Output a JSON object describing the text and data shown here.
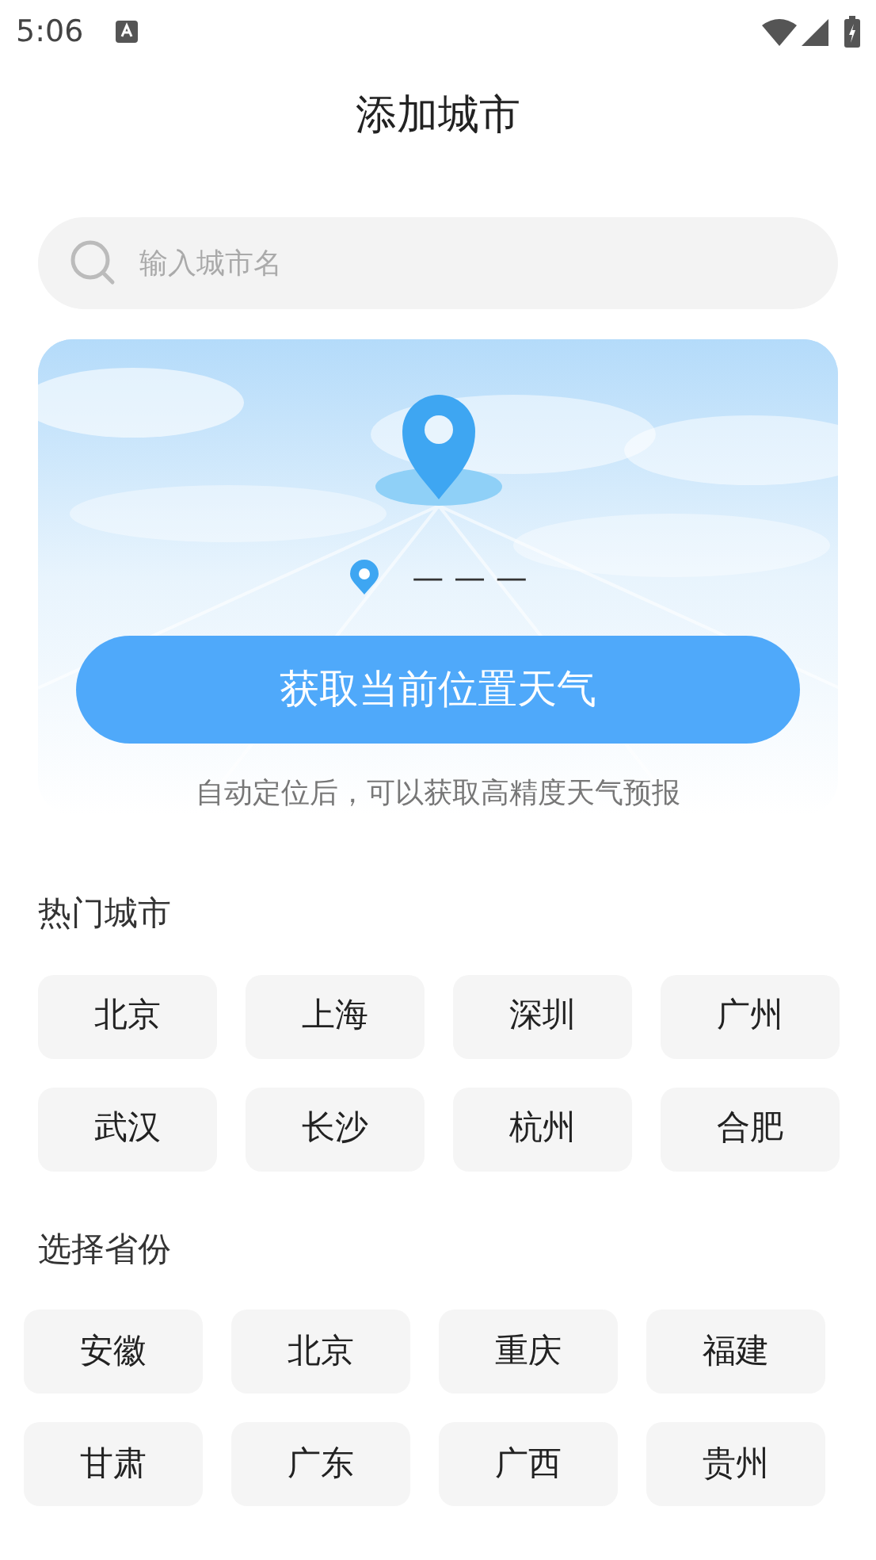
{
  "status_bar": {
    "time": "5:06"
  },
  "title": "添加城市",
  "search": {
    "placeholder": "输入城市名"
  },
  "location_card": {
    "place": "— — —",
    "button": "获取当前位置天气",
    "note": "自动定位后，可以获取高精度天气预报"
  },
  "hot_cities": {
    "heading": "热门城市",
    "items": [
      "北京",
      "上海",
      "深圳",
      "广州",
      "武汉",
      "长沙",
      "杭州",
      "合肥"
    ]
  },
  "provinces": {
    "heading": "选择省份",
    "items": [
      "安徽",
      "北京",
      "重庆",
      "福建",
      "甘肃",
      "广东",
      "广西",
      "贵州"
    ]
  }
}
